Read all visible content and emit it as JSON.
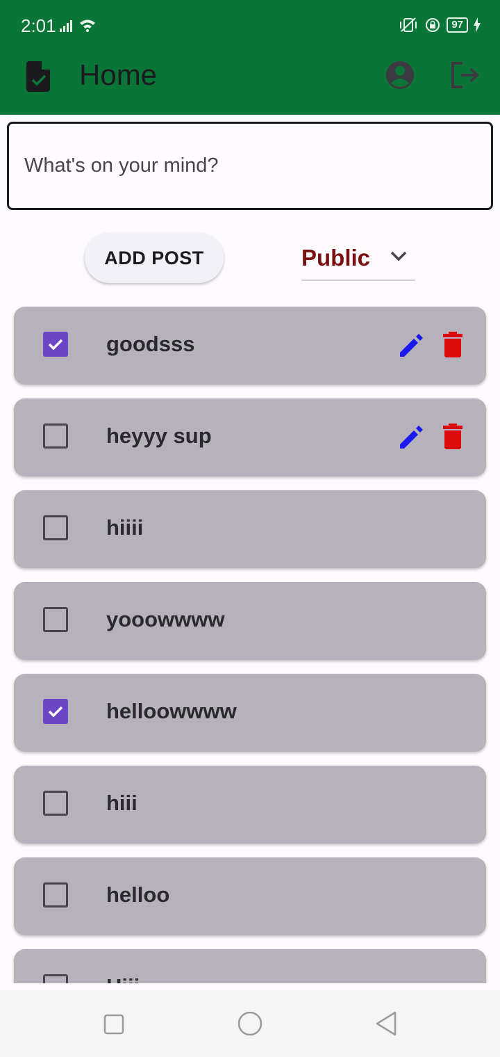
{
  "status_bar": {
    "time": "2:01",
    "battery": "97"
  },
  "app_bar": {
    "title": "Home"
  },
  "composer": {
    "placeholder": "What's on your mind?",
    "add_label": "ADD POST"
  },
  "visibility": {
    "selected": "Public"
  },
  "posts": [
    {
      "text": "goodsss",
      "checked": true,
      "editable": true
    },
    {
      "text": "heyyy sup",
      "checked": false,
      "editable": true
    },
    {
      "text": "hiiii",
      "checked": false,
      "editable": false
    },
    {
      "text": "yooowwww",
      "checked": false,
      "editable": false
    },
    {
      "text": "helloowwww",
      "checked": true,
      "editable": false
    },
    {
      "text": "hiii",
      "checked": false,
      "editable": false
    },
    {
      "text": "helloo",
      "checked": false,
      "editable": false
    },
    {
      "text": "Hiii",
      "checked": false,
      "editable": false
    }
  ],
  "colors": {
    "app_bar": "#0b7538",
    "card": "#b7b1bb",
    "checkbox": "#6a45c6",
    "edit": "#1a1aee",
    "delete": "#dd0b0b",
    "visibility": "#7a1010"
  },
  "icons": {
    "app": "task-document-icon",
    "profile": "account-circle-icon",
    "logout": "logout-icon",
    "edit": "pencil-icon",
    "delete": "trash-icon"
  }
}
